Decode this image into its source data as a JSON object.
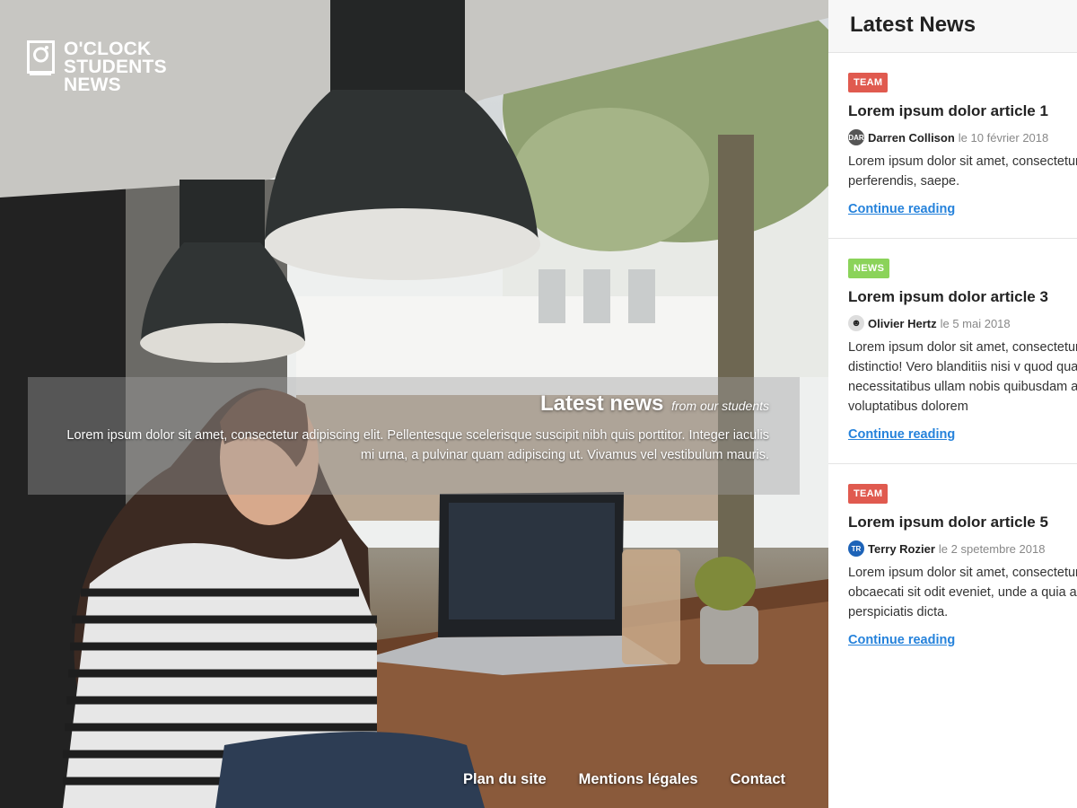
{
  "brand": {
    "line1": "O'CLOCK",
    "line2": "STUDENTS",
    "line3": "NEWS",
    "icon": "camera-logo-icon"
  },
  "intro": {
    "title": "Latest news",
    "subtitle": "from our students",
    "text": "Lorem ipsum dolor sit amet, consectetur adipiscing elit. Pellentesque scelerisque suscipit nibh quis porttitor. Integer iaculis mi urna, a pulvinar quam adipiscing ut. Vivamus vel vestibulum mauris."
  },
  "footer": {
    "links": [
      "Plan du site",
      "Mentions légales",
      "Contact"
    ]
  },
  "sidebar": {
    "title": "Latest News",
    "articles": [
      {
        "tag": "TEAM",
        "tag_color": "#e05a4f",
        "title": "Lorem ipsum dolor article 1",
        "avatar": "DAR",
        "avatar_color": "#555555",
        "author": "Darren Collison",
        "date": "le 10 février 2018",
        "excerpt": "Lorem ipsum dolor sit amet, consectetur perferendis, saepe.",
        "link": "Continue reading"
      },
      {
        "tag": "NEWS",
        "tag_color": "#8bd35a",
        "title": "Lorem ipsum dolor article 3",
        "avatar": "☻",
        "avatar_color": "#dddddd",
        "author": "Olivier Hertz",
        "date": "le 5 mai 2018",
        "excerpt": "Lorem ipsum dolor sit amet, consectetur magnam, distinctio! Vero blanditiis nisi v quod quaerat necessitatibus ullam nobis quibusdam ad quae voluptatibus dolorem",
        "link": "Continue reading"
      },
      {
        "tag": "TEAM",
        "tag_color": "#e05a4f",
        "title": "Lorem ipsum dolor article 5",
        "avatar": "TR",
        "avatar_color": "#1d63b8",
        "author": "Terry Rozier",
        "date": "le 2 spetembre 2018",
        "excerpt": "Lorem ipsum dolor sit amet, consectetur nostrum obcaecati sit odit eveniet, unde a quia aut perspiciatis dicta.",
        "link": "Continue reading"
      }
    ]
  },
  "colors": {
    "link": "#2582db",
    "team_tag": "#e05a4f",
    "news_tag": "#8bd35a"
  }
}
